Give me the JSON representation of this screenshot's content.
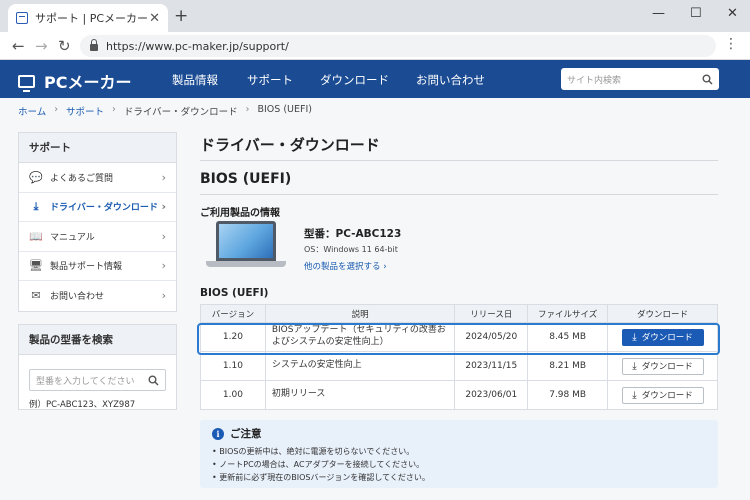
{
  "browser": {
    "tab_title": "サポート | PCメーカー",
    "tab_close": "✕",
    "new_tab": "+",
    "url": "https://www.pc-maker.jp/support/",
    "window_controls": [
      "—",
      "☐",
      "✕"
    ],
    "nav": {
      "back": "←",
      "forward": "→",
      "reload": "↻"
    },
    "menu": "⋮"
  },
  "site": {
    "logo": "PCメーカー",
    "nav": [
      "製品情報",
      "サポート",
      "ダウンロード",
      "お問い合わせ"
    ],
    "search_placeholder": "サイト内検索"
  },
  "breadcrumb": [
    "ホーム",
    "サポート",
    "ドライバー・ダウンロード",
    "BIOS (UEFI)"
  ],
  "sidebar": {
    "title": "サポート",
    "items": [
      {
        "label": "よくあるご質問",
        "icon": "chat-bubble-icon"
      },
      {
        "label": "ドライバー・ダウンロード",
        "icon": "download-icon",
        "active": true
      },
      {
        "label": "マニュアル",
        "icon": "book-icon"
      },
      {
        "label": "製品サポート情報",
        "icon": "monitor-icon"
      },
      {
        "label": "お問い合わせ",
        "icon": "mail-icon"
      }
    ]
  },
  "model_search": {
    "title": "製品の型番を検索",
    "placeholder": "型番を入力してください",
    "example": "例）PC-ABC123、XYZ987"
  },
  "main": {
    "title": "ドライバー・ダウンロード",
    "subtitle": "BIOS (UEFI)",
    "product_section": "ご利用製品の情報",
    "model": "型番：PC-ABC123",
    "os": "OS：Windows 11 64-bit",
    "other_product_link": "他の製品を選択する ›",
    "table_title": "BIOS (UEFI)"
  },
  "bios_table": {
    "headers": [
      "バージョン",
      "説明",
      "リリース日",
      "ファイルサイズ",
      "ダウンロード"
    ],
    "rows": [
      {
        "version": "1.20",
        "description": "BIOSアップデート（セキュリティの改善およびシステムの安定性向上）",
        "date": "2024/05/20",
        "size": "8.45 MB",
        "button": "ダウンロード",
        "highlighted": true
      },
      {
        "version": "1.10",
        "description": "システムの安定性向上",
        "date": "2023/11/15",
        "size": "8.21 MB",
        "button": "ダウンロード"
      },
      {
        "version": "1.00",
        "description": "初期リリース",
        "date": "2023/06/01",
        "size": "7.98 MB",
        "button": "ダウンロード"
      }
    ]
  },
  "notice": {
    "title": "ご注意",
    "items": [
      "BIOSの更新中は、絶対に電源を切らないでください。",
      "ノートPCの場合は、ACアダプターを接続してください。",
      "更新前に必ず現在のBIOSバージョンを確認してください。"
    ]
  },
  "colors": {
    "brand": "#1a4b93",
    "accent": "#1c5bb5",
    "highlight": "#2a7ad0"
  }
}
